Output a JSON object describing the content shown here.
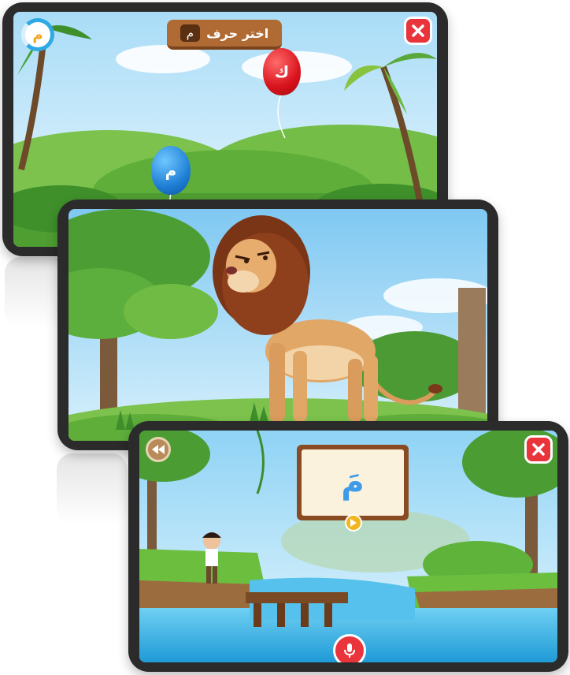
{
  "screen1": {
    "title_label": "اختر حرف",
    "title_letter": "م",
    "timer_letter": "م",
    "balloon_red_letter": "ك",
    "balloon_blue_letter": "م",
    "close_icon": "close-icon"
  },
  "screen2": {
    "scene": "lion-scene"
  },
  "screen3": {
    "card_letter": "مَ",
    "rewind_icon": "rewind-icon",
    "play_icon": "play-icon",
    "mic_icon": "microphone-icon",
    "close_icon": "close-icon"
  },
  "colors": {
    "sky": "#bfe6fb",
    "grass": "#5fb33b",
    "close_red": "#e8343a",
    "wood": "#a0592c",
    "water": "#35b6e6"
  }
}
